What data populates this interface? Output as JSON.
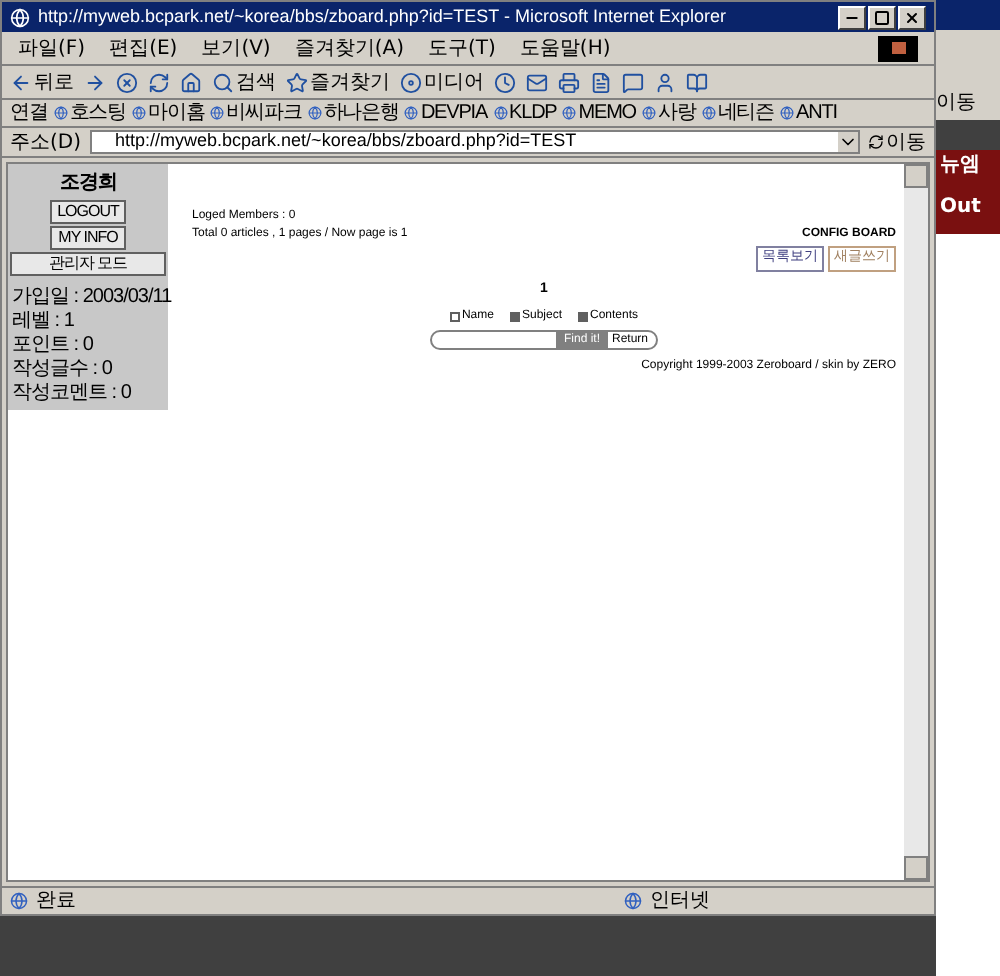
{
  "window": {
    "title": "http://myweb.bcpark.net/~korea/bbs/zboard.php?id=TEST - Microsoft Internet Explorer"
  },
  "menu": [
    "파일(F)",
    "편집(E)",
    "보기(V)",
    "즐겨찾기(A)",
    "도구(T)",
    "도움말(H)"
  ],
  "toolbar": [
    {
      "kind": "back",
      "label": "뒤로"
    },
    {
      "kind": "forward"
    },
    {
      "kind": "stop"
    },
    {
      "kind": "refresh"
    },
    {
      "kind": "home"
    },
    {
      "kind": "search",
      "label": "검색"
    },
    {
      "kind": "favorites",
      "label": "즐겨찾기"
    },
    {
      "kind": "media",
      "label": "미디어"
    },
    {
      "kind": "history"
    },
    {
      "kind": "mail"
    },
    {
      "kind": "print"
    },
    {
      "kind": "edit"
    },
    {
      "kind": "discuss"
    },
    {
      "kind": "messenger"
    },
    {
      "kind": "research"
    }
  ],
  "links": {
    "label": "연결",
    "items": [
      "호스팅",
      "마이홈",
      "비씨파크",
      "하나은행",
      "DEVPIA",
      "KLDP",
      "MEMO",
      "사랑",
      "네티즌",
      "ANTI"
    ]
  },
  "address": {
    "label": "주소(D)",
    "value": "http://myweb.bcpark.net/~korea/bbs/zboard.php?id=TEST",
    "go": "이동"
  },
  "sidebar": {
    "user": "조경희",
    "buttons": [
      "LOGOUT",
      "MY INFO",
      "관리자 모드"
    ],
    "info": [
      "가입일 : 2003/03/11",
      "레벨 : 1",
      "포인트 : 0",
      "작성글수 : 0",
      "작성코멘트 : 0"
    ]
  },
  "board": {
    "members": "Loged Members : 0",
    "total": "Total  0 articles ,  1 pages / Now page is  1",
    "config": "CONFIG BOARD",
    "buttons": [
      "목록보기",
      "새글쓰기"
    ],
    "page": "1",
    "options": [
      {
        "label": "Name",
        "checked": false
      },
      {
        "label": "Subject",
        "checked": true
      },
      {
        "label": "Contents",
        "checked": true
      }
    ],
    "find": "Find it!",
    "return": "Return",
    "copyright": "Copyright 1999-2003 Zeroboard / skin by ZERO"
  },
  "status": {
    "text": "완료",
    "zone": "인터넷"
  },
  "background_window": {
    "go": "이동",
    "tab": "뉴엠",
    "button": "Out"
  }
}
